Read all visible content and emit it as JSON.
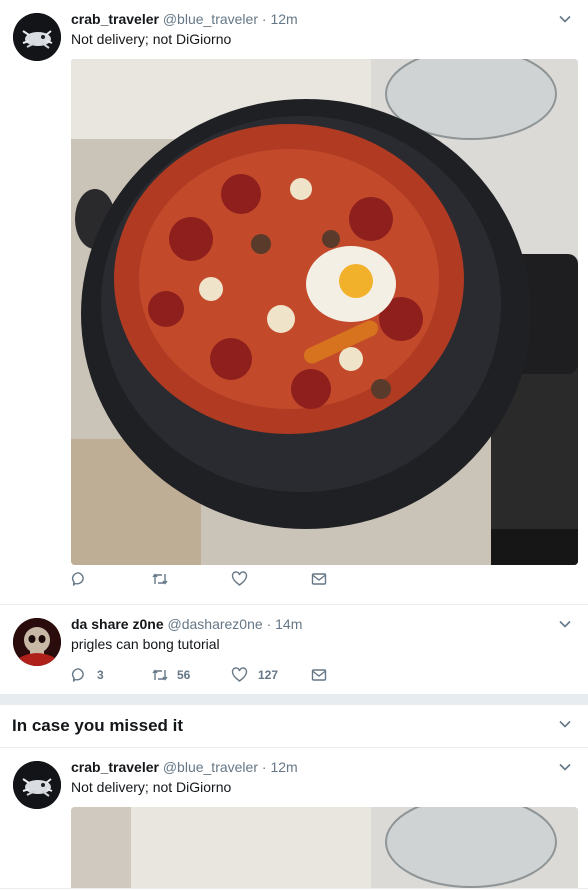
{
  "tweets": [
    {
      "name": "crab_traveler",
      "handle": "@blue_traveler",
      "dot": "·",
      "time": "12m",
      "text": "Not delivery; not DiGiorno",
      "media": "photo of homemade pizza with egg in cast iron pan on stove"
    },
    {
      "name": "da share z0ne",
      "handle": "@dasharez0ne",
      "dot": "·",
      "time": "14m",
      "text": "prigles can bong tutorial",
      "replies": "3",
      "retweets": "56",
      "likes": "127"
    }
  ],
  "section": {
    "title": "In case you missed it"
  },
  "missed": {
    "name": "crab_traveler",
    "handle": "@blue_traveler",
    "dot": "·",
    "time": "12m",
    "text": "Not delivery; not DiGiorno"
  },
  "icons": {
    "reply": "reply-icon",
    "retweet": "retweet-icon",
    "like": "heart-icon",
    "dm": "envelope-icon",
    "caret": "chevron-down-icon"
  },
  "colors": {
    "muted": "#657786",
    "text": "#14171a",
    "bg": "#e6ecf0"
  }
}
